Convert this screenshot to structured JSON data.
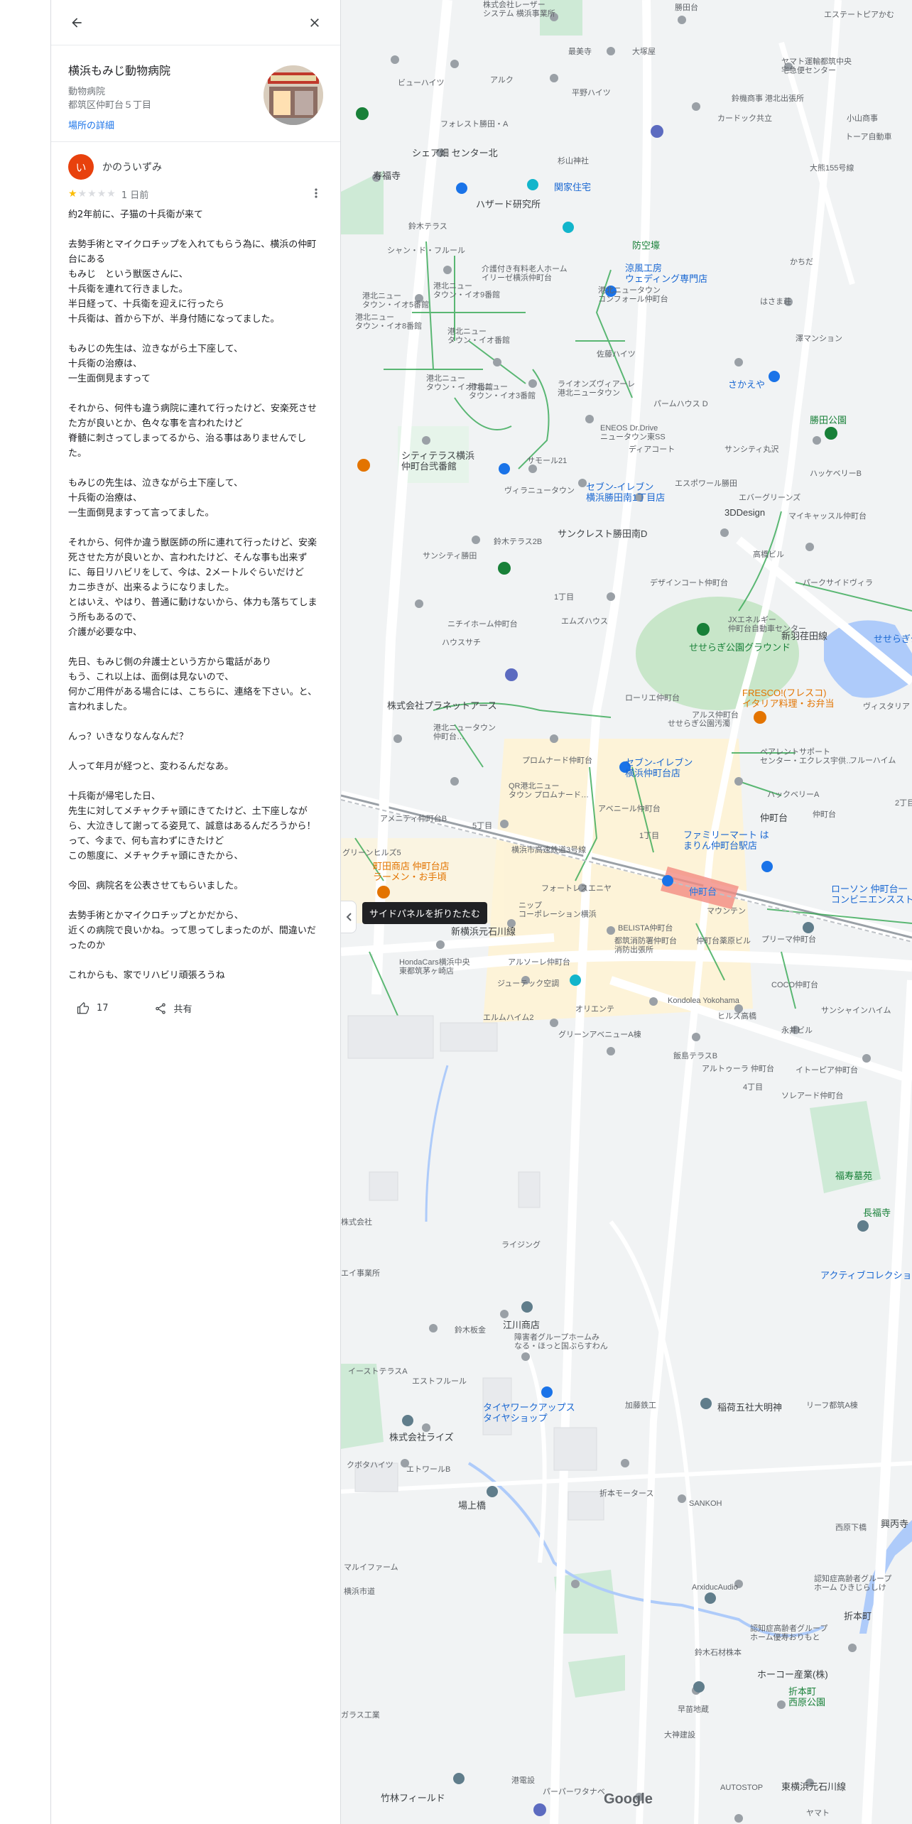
{
  "place": {
    "name": "横浜もみじ動物病院",
    "category": "動物病院",
    "address": "都筑区仲町台５丁目",
    "details_link": "場所の詳細"
  },
  "review": {
    "avatar_letter": "い",
    "reviewer_name": "かのういずみ",
    "rating": 1,
    "time": "1 日前",
    "paragraphs": [
      "約2年前に、子猫の十兵衛が来て",
      "去勢手術とマイクロチップを入れてもらう為に、横浜の仲町台にある\nもみじ　という獣医さんに、\n十兵衛を連れて行きました。\n半日経って、十兵衛を迎えに行ったら\n十兵衛は、首から下が、半身付随になってました。",
      "もみじの先生は、泣きながら土下座して、\n十兵衛の治療は、\n一生面倒見ますって",
      "それから、何件も違う病院に連れて行ったけど、安楽死させた方が良いとか、色々な事を言われたけど\n脊髄に刺さってしまってるから、治る事はありませんでした。",
      "もみじの先生は、泣きながら土下座して、\n十兵衛の治療は、\n一生面倒見ますって言ってました。",
      "それから、何件か違う獣医師の所に連れて行ったけど、安楽死させた方が良いとか、言われたけど、そんな事も出来ずに、毎日リハビリをして、今は、2メートルぐらいだけど\nカニ歩きが、出来るようになりました。\nとはいえ、やはり、普通に動けないから、体力も落ちてしまう所もあるので、\n介護が必要な中、",
      "先日、もみじ側の弁護士という方から電話があり\nもう、これ以上は、面倒は見ないので、\n何かご用件がある場合には、こちらに、連絡を下さい。と、言われました。",
      "んっ？いきなりなんなんだ？",
      "人って年月が経つと、変わるんだなあ。",
      "十兵衛が帰宅した日、\n先生に対してメチャクチャ頭にきてたけど、土下座しながら、大泣きして謝ってる姿見て、誠意はあるんだろうから！って、今まで、何も言わずにきたけど\nこの態度に、メチャクチャ頭にきたから、",
      "今回、病院名を公表させてもらいました。",
      "去勢手術とかマイクロチップとかだから、\n近くの病院で良いかね。って思ってしまったのが、間違いだったのか",
      "これからも、家でリハビリ頑張ろうね"
    ],
    "like_count": "17",
    "share_label": "共有"
  },
  "map": {
    "tooltip": "サイドパネルを折りたたむ",
    "google_logo": "Google",
    "labels": {
      "l1": "株式会社レーザー\nシステム 横浜事業所",
      "l2": "勝田台",
      "l3": "エステートピアかむ",
      "l4": "大塚屋",
      "l5": "最美寺",
      "l6": "ヤマト運輸都筑中央\n宅急便センター",
      "l7": "ビューハイツ",
      "l8": "アルク",
      "l9": "平野ハイツ",
      "l10": "鈴機商事 港北出張所",
      "l11": "小山商事",
      "l12": "カードック共立",
      "l13": "トーア自動車",
      "l14": "フォレスト勝田・A",
      "l15": "杉山神社",
      "l16": "シェア畑 センター北",
      "l17": "寿福寺",
      "l18": "ハザード研究所",
      "l19": "関家住宅",
      "l20": "鈴木テラス",
      "l21": "防空壕",
      "l22": "シャン・ド・フルール",
      "l23": "介護付き有料老人ホーム\nイリーゼ横浜仲町台",
      "l24": "涼風工房\nウェディング専門店",
      "l25": "はさま荘",
      "l26": "かちだ",
      "l27": "港北ニュータウン\nコンフォール仲町台",
      "l28": "澤マンション",
      "l29": "佐藤ハイツ",
      "l30": "さかえや",
      "l31": "ライオンズヴィアーレ\n港北ニュータウン",
      "l32": "パームハウス D",
      "l33": "勝田公園",
      "l34": "ENEOS Dr.Drive\nニュータウン東SS",
      "l35": "ディアコート",
      "l36": "サンシティ丸沢",
      "l37": "シティテラス横浜\n仲町台弐番館",
      "l38": "サモール21",
      "l39": "ハッケベリーB",
      "l40": "セブン-イレブン\n横浜勝田南1丁目店",
      "l41": "エスポワール勝田",
      "l42": "ヴィラニュータウン",
      "l43": "エバーグリーンズ",
      "l44": "3DDesign",
      "l45": "マイキャッスル仲町台",
      "l46": "サンクレスト勝田南D",
      "l47": "高橋ビル",
      "l48": "鈴木テラス2B",
      "l49": "サンシティ勝田",
      "l50": "デザインコート仲町台",
      "l51": "パークサイドヴィラ",
      "l52": "1丁目",
      "l53": "ニチイホーム仲町台",
      "l54": "エムズハウス",
      "l55": "JXエネルギー\n仲町台自動車センター",
      "l56": "ハウスサチ",
      "l57": "せせらぎ公園グラウンド",
      "l58": "新羽荏田線",
      "l59": "せせらぎ公園",
      "l60": "株式会社プラネットアース",
      "l61": "ローリエ仲町台",
      "l62": "ヴィスタリア",
      "l63": "FRESCO!(フレスコ)\nイタリア料理・お弁当",
      "l64": "港北ニュータウン\n仲町台…",
      "l65": "アルス仲町台",
      "l66": "せせらぎ公園汚濁",
      "l67": "プロムナード仲町台",
      "l68": "セブン-イレブン\n横浜仲町台店",
      "l69": "ペアレントサポート\nセンター・エクレス宇供…",
      "l70": "フルーハイム",
      "l71": "ハックベリーA",
      "l72": "仲町台",
      "l73": "2丁目",
      "l74": "QR港北ニュー\nタウン プロムナード…",
      "l75": "アベニール仲町台",
      "l76": "アメニティ仲町台B",
      "l77": "5丁目",
      "l78": "1丁目",
      "l79": "ファミリーマート は\nまりん仲町台駅店",
      "l80": "グリーンヒルズ5",
      "l81": "町田商店 仲町台店\nラーメン・お手頃",
      "l82": "フォートレスエニヤ",
      "l83": "仲町台",
      "l84": "マウンテン",
      "l85": "ローソン 仲町台一\nコンビニエンスストア",
      "l86": "ニップ\nコーポレーション横浜",
      "l87": "BELISTA仲町台",
      "l88": "都筑消防署仲町台\n消防出張所",
      "l89": "仲町台薬原ビル",
      "l90": "プリーマ仲町台",
      "l91": "新横浜元石川線",
      "l92": "HondaCars横浜中央\n東都筑茅ヶ崎店",
      "l93": "アルソーレ仲町台",
      "l94": "ジューテック空調",
      "l95": "Kondolea Yokohama",
      "l96": "COCO仲町台",
      "l97": "サンシャインハイム",
      "l98": "オリエンテ",
      "l99": "ヒルズ高橋",
      "l100": "エルムハイム2",
      "l101": "グリーンアベニューA棟",
      "l102": "永井ビル",
      "l103": "飯島テラスB",
      "l104": "アルトゥーラ 仲町台",
      "l105": "イトーピア仲町台",
      "l106": "4丁目",
      "l107": "ソレアード仲町台",
      "l108": "福寿墓苑",
      "l109": "長福寺",
      "l110": "アクティブコレクション",
      "l111": "株式会社",
      "l112": "ライジング",
      "l113": "江川商店",
      "l114": "障害者グループホームみ\nなる・ほっと国ぶらすわん",
      "l115": "鈴木板金",
      "l116": "イーストテラスA",
      "l117": "エストフルール",
      "l118": "タイヤワークアップス\nタイヤショップ",
      "l119": "加藤鉄工",
      "l120": "稲荷五社大明神",
      "l121": "リーフ都筑A棟",
      "l122": "株式会社ライズ",
      "l123": "クボタハイツ",
      "l124": "エトワールB",
      "l125": "折本モータース",
      "l126": "SANKOH",
      "l127": "西原下橋",
      "l128": "場上橋",
      "l129": "マルイファーム",
      "l130": "ArxiducAudio",
      "l131": "認知症高齢者グループ\nホーム ひきじらしけ",
      "l132": "折本町",
      "l133": "認知症高齢者グループ\nホーム優寿おりもと",
      "l134": "鈴木石材株本",
      "l135": "ホーコー産業(株)",
      "l136": "折本町\n西原公園",
      "l137": "早苗地蔵",
      "l138": "大神建設",
      "l139": "ガラス工業",
      "l140": "竹林フィールド",
      "l141": "港電設",
      "l142": "パーパーワタナベ",
      "l143": "AUTOSTOP",
      "l144": "ヤマト",
      "l145": "仲町台",
      "l146": "港北ニュー\nタウン・イオ9番館",
      "l147": "港北ニュー\nタウン・イオ5番館",
      "l148": "港北ニュー\nタウン・イオ番館",
      "l149": "港北ニュー\nタウン・イオ7番館",
      "l150": "港北ニュー\nタウン・イオ8番館",
      "l151": "港北ニュー\nタウン・イオ3番館",
      "l152": "エイ事業所",
      "l153": "興丙寺",
      "l154": "横浜市高速鉄道3号線",
      "l155": "大熊155号線",
      "l156": "横浜市道",
      "l157": "東横浜元石川線"
    }
  }
}
